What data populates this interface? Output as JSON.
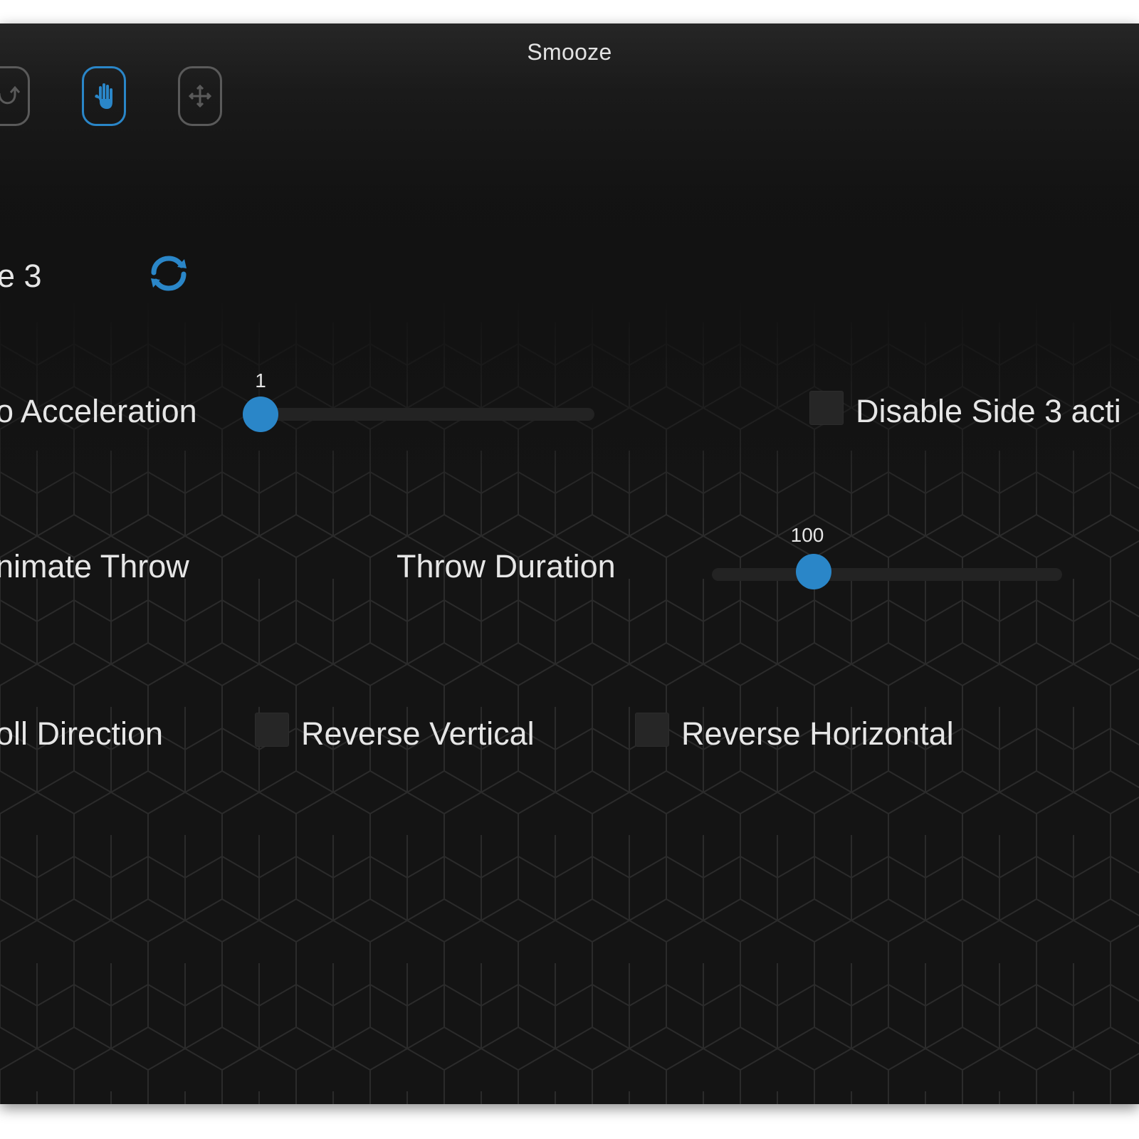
{
  "window": {
    "title": "Smooze"
  },
  "toolbar": {
    "buttons": [
      {
        "name": "undo-action",
        "icon": "undo-arrow-icon",
        "active": false
      },
      {
        "name": "grab-scroll",
        "icon": "hand-icon",
        "active": true
      },
      {
        "name": "move-pan",
        "icon": "move-arrows-icon",
        "active": false
      }
    ]
  },
  "profile": {
    "name_fragment": "e 3",
    "refresh_icon": "refresh-icon"
  },
  "acceleration": {
    "label": "o Acceleration",
    "value": "1",
    "value_fraction": 0.0
  },
  "disable_side": {
    "label": "Disable Side 3 acti",
    "checked": false
  },
  "throw": {
    "animate_label": "nimate Throw",
    "duration_label": "Throw Duration",
    "duration_value": "100",
    "duration_fraction": 0.27
  },
  "scroll_direction": {
    "label": "oll Direction",
    "reverse_vertical_label": "Reverse Vertical",
    "reverse_vertical_checked": false,
    "reverse_horizontal_label": "Reverse Horizontal",
    "reverse_horizontal_checked": false
  },
  "colors": {
    "accent": "#2a86c8",
    "background": "#141414",
    "text": "#e6e6e6"
  }
}
